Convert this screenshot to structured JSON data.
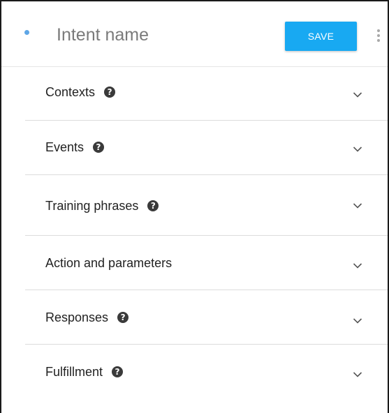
{
  "header": {
    "intent_name_placeholder": "Intent name",
    "save_label": "SAVE",
    "status_dot_color": "#5ea6e6",
    "accent_color": "#18a9f2",
    "more_icon": "more-vert-icon"
  },
  "sections": [
    {
      "label": "Contexts",
      "help_icon": "help-icon",
      "expand_icon": "chevron-down-icon"
    },
    {
      "label": "Events",
      "help_icon": "help-icon",
      "expand_icon": "chevron-down-icon"
    },
    {
      "label": "Training phrases",
      "help_icon": "help-icon",
      "expand_icon": "chevron-down-icon"
    },
    {
      "label": "Action and parameters",
      "expand_icon": "chevron-down-icon"
    },
    {
      "label": "Responses",
      "help_icon": "help-icon",
      "expand_icon": "chevron-down-icon"
    },
    {
      "label": "Fulfillment",
      "help_icon": "help-icon",
      "expand_icon": "chevron-down-icon"
    }
  ]
}
